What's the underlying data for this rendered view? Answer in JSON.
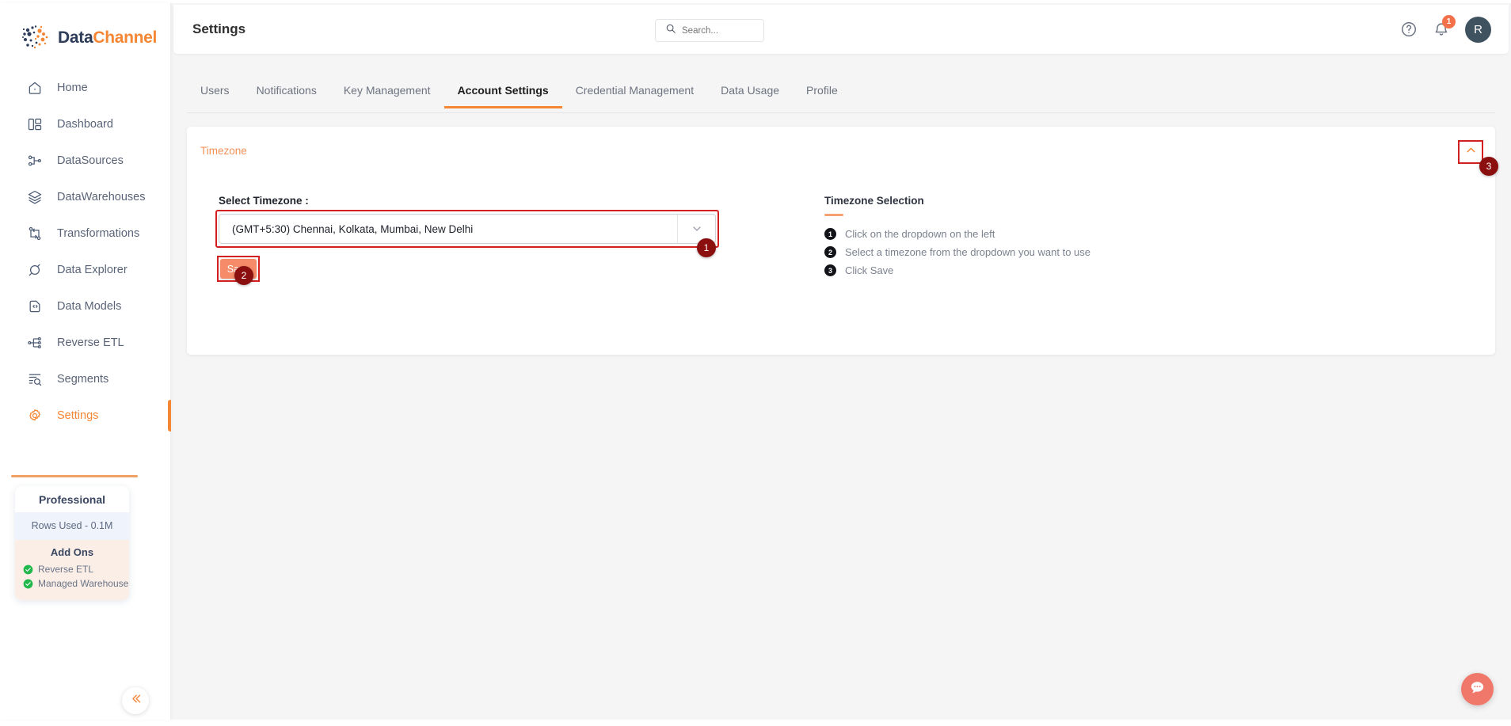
{
  "brand": {
    "part1": "Data",
    "part2": "Channel"
  },
  "sidebar": {
    "items": [
      {
        "label": "Home",
        "icon": "home-icon"
      },
      {
        "label": "Dashboard",
        "icon": "dashboard-icon"
      },
      {
        "label": "DataSources",
        "icon": "datasources-icon"
      },
      {
        "label": "DataWarehouses",
        "icon": "datawarehouses-icon"
      },
      {
        "label": "Transformations",
        "icon": "transformations-icon"
      },
      {
        "label": "Data Explorer",
        "icon": "data-explorer-icon"
      },
      {
        "label": "Data Models",
        "icon": "data-models-icon"
      },
      {
        "label": "Reverse ETL",
        "icon": "reverse-etl-icon"
      },
      {
        "label": "Segments",
        "icon": "segments-icon"
      },
      {
        "label": "Settings",
        "icon": "gear-icon"
      }
    ],
    "active_item": "Settings",
    "plan": {
      "title": "Professional",
      "rows_used": "Rows Used - 0.1M",
      "addons_heading": "Add Ons",
      "addons": [
        "Reverse ETL",
        "Managed Warehouse"
      ]
    },
    "collapse_icon": "chevron-double-left-icon"
  },
  "header": {
    "title": "Settings",
    "search_placeholder": "Search...",
    "search_value": "",
    "help_icon": "question-circle-icon",
    "bell_icon": "bell-icon",
    "notification_count": "1",
    "avatar_initial": "R"
  },
  "tabs": [
    {
      "label": "Users",
      "active": false
    },
    {
      "label": "Notifications",
      "active": false
    },
    {
      "label": "Key Management",
      "active": false
    },
    {
      "label": "Account Settings",
      "active": true
    },
    {
      "label": "Credential Management",
      "active": false
    },
    {
      "label": "Data Usage",
      "active": false
    },
    {
      "label": "Profile",
      "active": false
    }
  ],
  "card": {
    "label": "Timezone",
    "collapse_icon": "chevron-up-icon",
    "field_label": "Select Timezone :",
    "selected_timezone": "(GMT+5:30) Chennai, Kolkata, Mumbai, New Delhi",
    "dropdown_icon": "chevron-down-icon",
    "save_label": "Save"
  },
  "instructions": {
    "title": "Timezone Selection",
    "steps": [
      {
        "num": "1",
        "text": "Click on the dropdown on the left"
      },
      {
        "num": "2",
        "text": "Select a timezone from the dropdown you want to use"
      },
      {
        "num": "3",
        "text": "Click Save"
      }
    ]
  },
  "annotations": {
    "badge1": "1",
    "badge2": "2",
    "badge3": "3"
  },
  "chat": {
    "icon": "chat-bubble-icon"
  },
  "colors": {
    "accent": "#f58634",
    "navy": "#2d3c59",
    "badge_red": "#8c0f0f",
    "highlight_red": "#d31f1f",
    "save_orange": "#f58b68",
    "notif_orange": "#f2714b"
  }
}
